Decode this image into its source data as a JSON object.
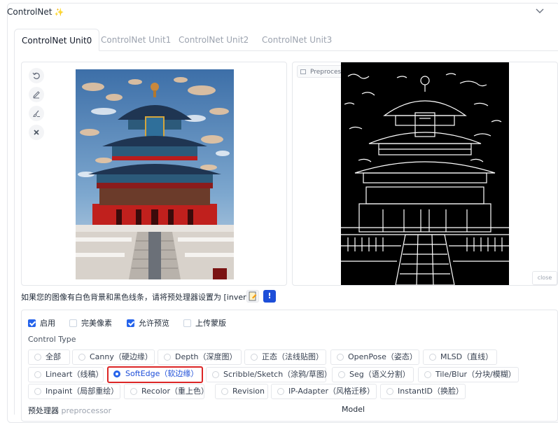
{
  "header": {
    "title": "ControlNet",
    "title_icon": "sparkle-icon"
  },
  "tabs": [
    {
      "label": "ControlNet Unit0",
      "active": true
    },
    {
      "label": "ControlNet Unit1",
      "active": false
    },
    {
      "label": "ControlNet Unit2",
      "active": false
    },
    {
      "label": "ControlNet Unit3",
      "active": false
    }
  ],
  "input_image": {
    "tools": [
      "undo-icon",
      "pencil-icon",
      "brush-icon",
      "close-icon"
    ]
  },
  "preview": {
    "label": "Preprocessor Preview",
    "close_label": "close"
  },
  "hint": {
    "text": "如果您的图像有白色背景和黑色线条，请将预处理器设置为 [invert]."
  },
  "checkboxes": [
    {
      "label": "启用",
      "checked": true
    },
    {
      "label": "完美像素",
      "checked": false
    },
    {
      "label": "允许预览",
      "checked": true
    },
    {
      "label": "上传蒙版",
      "checked": false
    }
  ],
  "control_type": {
    "label": "Control Type",
    "options": [
      {
        "label": "全部",
        "selected": false
      },
      {
        "label": "Canny（硬边缘）",
        "selected": false
      },
      {
        "label": "Depth（深度图）",
        "selected": false
      },
      {
        "label": "正态（法线贴图）",
        "selected": false
      },
      {
        "label": "OpenPose（姿态）",
        "selected": false
      },
      {
        "label": "MLSD（直线）",
        "selected": false
      },
      {
        "label": "Lineart（线稿）",
        "selected": false
      },
      {
        "label": "SoftEdge（软边缘）",
        "selected": true
      },
      {
        "label": "Scribble/Sketch（涂鸦/草图）",
        "selected": false
      },
      {
        "label": "Seg（语义分割）",
        "selected": false
      },
      {
        "label": "Tile/Blur（分块/模糊）",
        "selected": false
      },
      {
        "label": "Inpaint（局部重绘）",
        "selected": false
      },
      {
        "label": "Recolor（重上色）",
        "selected": false
      },
      {
        "label": "Revision",
        "selected": false
      },
      {
        "label": "IP-Adapter（风格迁移）",
        "selected": false
      },
      {
        "label": "InstantID（换脸）",
        "selected": false
      }
    ]
  },
  "bottom": {
    "preprocessor_label": "预处理器",
    "preprocessor_sub": "preprocessor",
    "model_label": "Model"
  },
  "colors": {
    "accent": "#2563eb",
    "highlight_border": "#dc2626"
  }
}
